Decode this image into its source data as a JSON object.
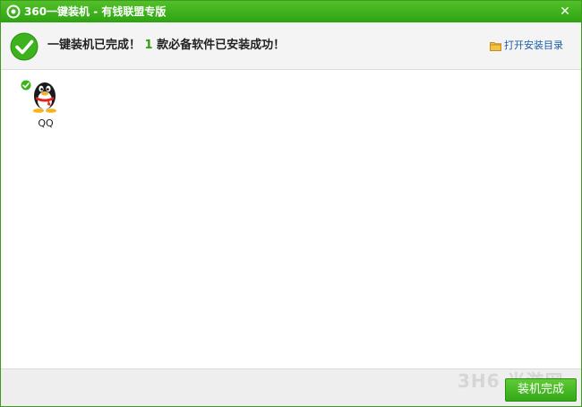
{
  "window": {
    "title": "360一键装机 - 有钱联盟专版",
    "close_glyph": "✕"
  },
  "header": {
    "status_part1": "一键装机已完成！",
    "installed_count": "1",
    "status_part2": "款必备软件已安装成功！",
    "open_dir_label": "打开安装目录",
    "icons": {
      "status": "check-circle-icon",
      "folder": "folder-icon"
    }
  },
  "apps": [
    {
      "name": "QQ",
      "icon": "qq-penguin-icon",
      "status_icon": "check-icon"
    }
  ],
  "footer": {
    "watermark": "3H6 当游网",
    "finish_label": "装机完成"
  },
  "colors": {
    "titlebar": "#3aad1c",
    "accent_green": "#2e9e17",
    "link_blue": "#1b5ea8",
    "button_green": "#45b826"
  }
}
